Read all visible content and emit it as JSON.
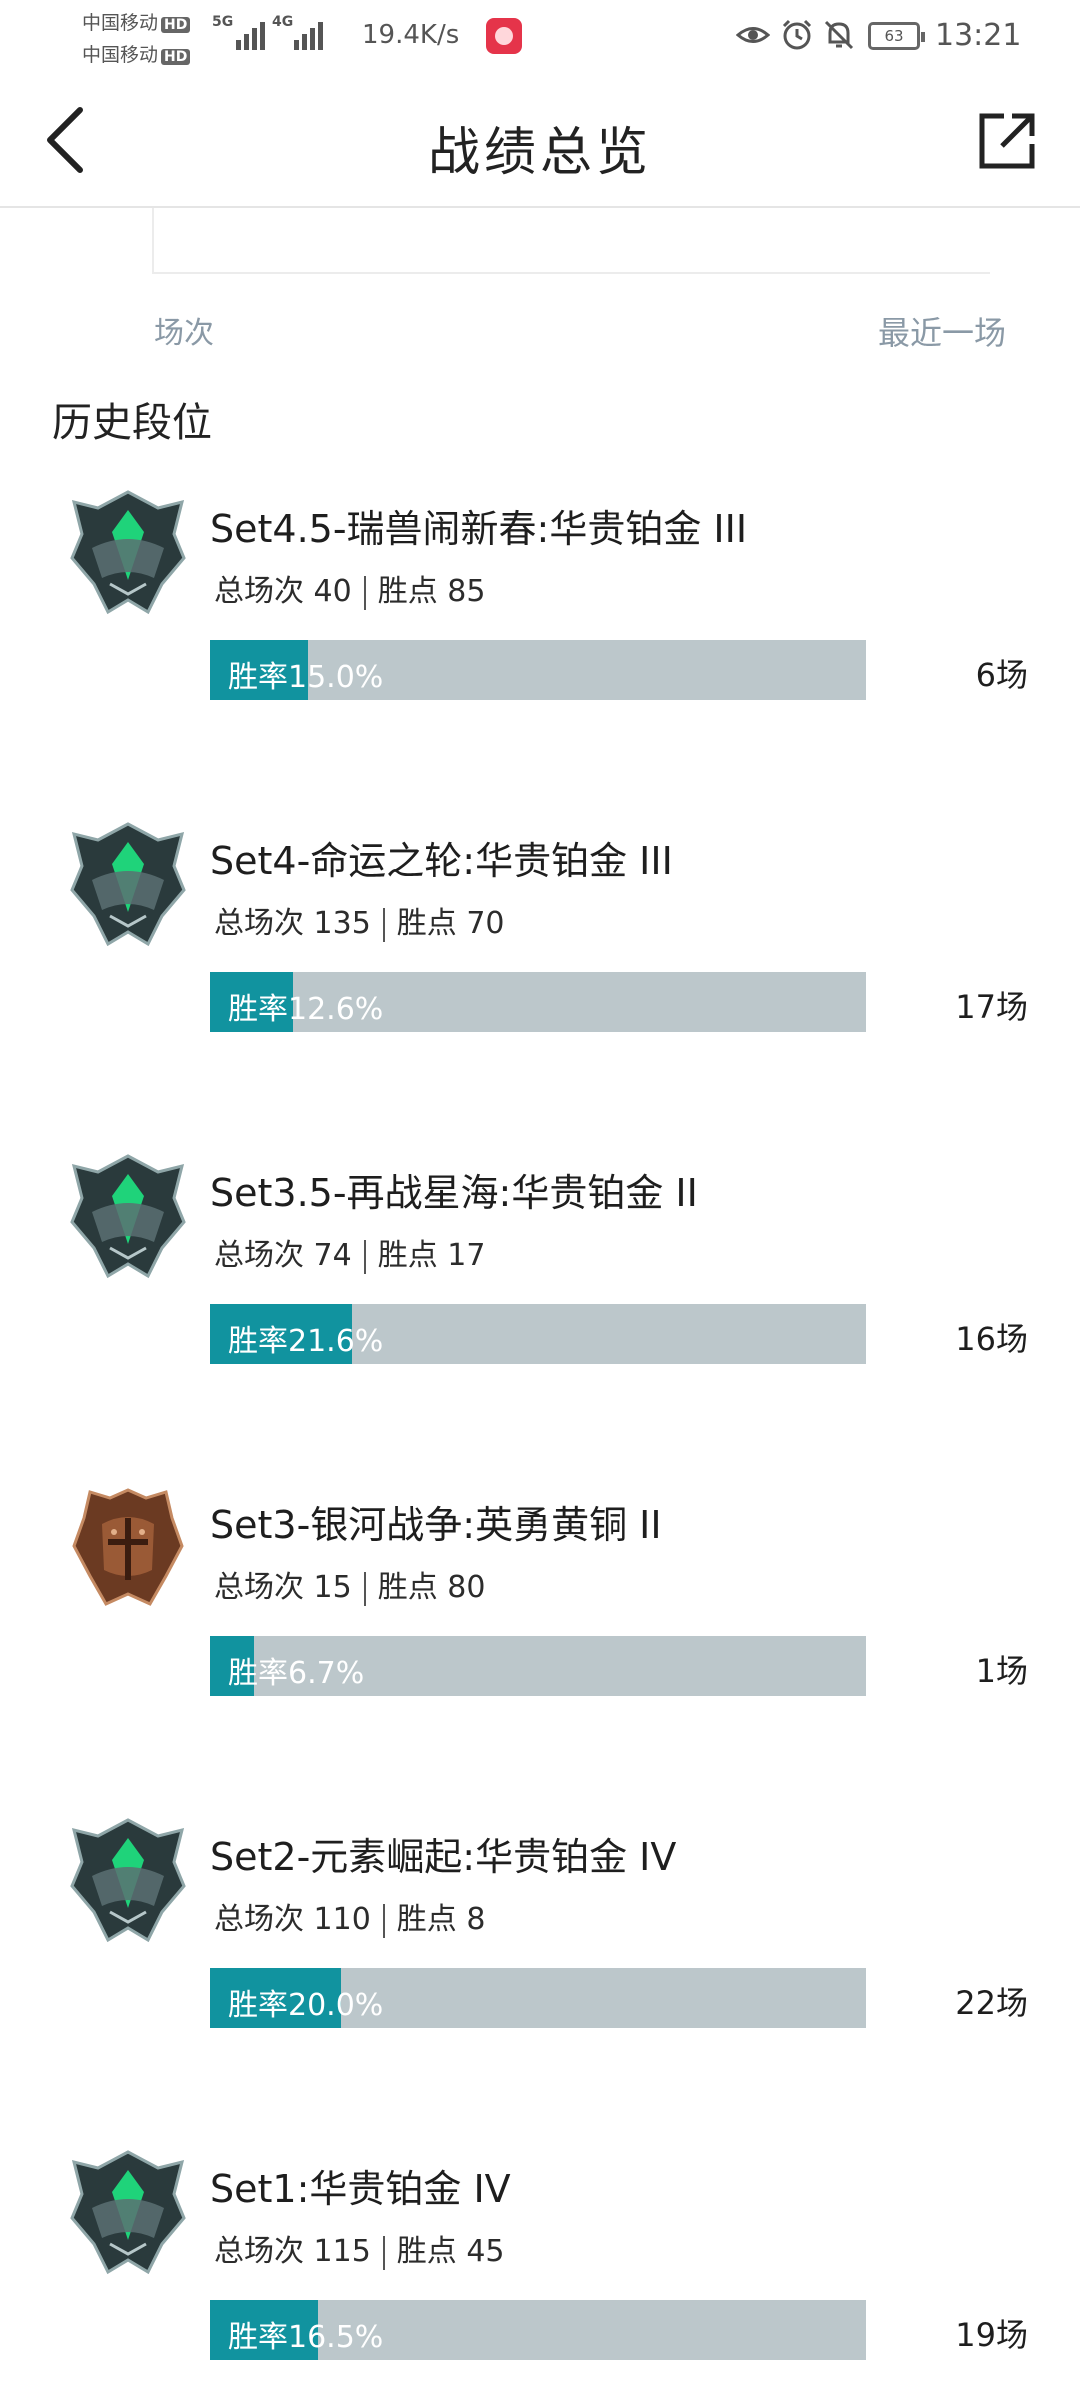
{
  "status_bar": {
    "carrier1": "中国移动",
    "carrier2": "中国移动",
    "hd_badge": "HD",
    "net1": "5G",
    "net2": "4G",
    "net_speed": "19.4K/s",
    "battery": "63",
    "time": "13:21"
  },
  "header": {
    "title": "战绩总览",
    "back_icon": "chevron-left-icon",
    "share_icon": "external-share-icon"
  },
  "summary": {
    "games_label": "场次",
    "recent_label": "最近一场"
  },
  "section_title": "历史段位",
  "colors": {
    "accent": "#11939f",
    "bar_track": "#bcc7cb",
    "muted_text": "#8a99a6"
  },
  "seasons": [
    {
      "name": "Set4.5-瑞兽闹新春:华贵铂金 III",
      "total_games": "总场次 40",
      "points": "胜点 85",
      "win_rate_text": "胜率15.0%",
      "win_rate": 0.15,
      "recent": "6场",
      "emblem": "platinum"
    },
    {
      "name": "Set4-命运之轮:华贵铂金 III",
      "total_games": "总场次 135",
      "points": "胜点 70",
      "win_rate_text": "胜率12.6%",
      "win_rate": 0.126,
      "recent": "17场",
      "emblem": "platinum"
    },
    {
      "name": "Set3.5-再战星海:华贵铂金 II",
      "total_games": "总场次 74",
      "points": "胜点 17",
      "win_rate_text": "胜率21.6%",
      "win_rate": 0.216,
      "recent": "16场",
      "emblem": "platinum"
    },
    {
      "name": "Set3-银河战争:英勇黄铜 II",
      "total_games": "总场次 15",
      "points": "胜点 80",
      "win_rate_text": "胜率6.7%",
      "win_rate": 0.067,
      "recent": "1场",
      "emblem": "bronze"
    },
    {
      "name": "Set2-元素崛起:华贵铂金 IV",
      "total_games": "总场次 110",
      "points": "胜点 8",
      "win_rate_text": "胜率20.0%",
      "win_rate": 0.2,
      "recent": "22场",
      "emblem": "platinum"
    },
    {
      "name": "Set1:华贵铂金 IV",
      "total_games": "总场次 115",
      "points": "胜点 45",
      "win_rate_text": "胜率16.5%",
      "win_rate": 0.165,
      "recent": "19场",
      "emblem": "platinum"
    }
  ]
}
